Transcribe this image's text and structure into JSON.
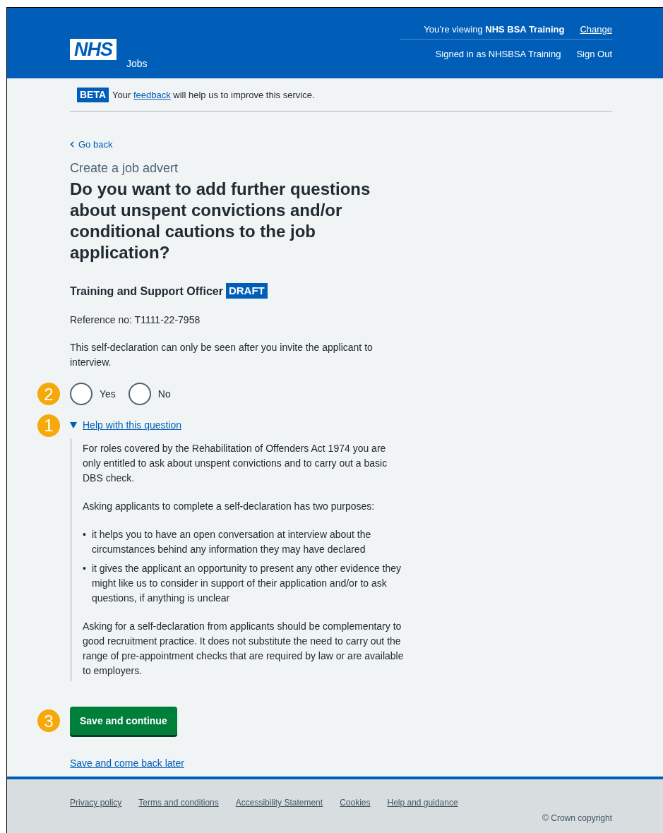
{
  "header": {
    "logo": "NHS",
    "service": "Jobs",
    "viewing_prefix": "You’re viewing",
    "viewing_org": "NHS BSA Training",
    "change_link": "Change",
    "signed_in": "Signed in as NHSBSA Training",
    "sign_out": "Sign Out"
  },
  "beta": {
    "tag": "BETA",
    "prefix": "Your",
    "link": "feedback",
    "suffix": "will help us to improve this service."
  },
  "back_link": "Go back",
  "caption": "Create a job advert",
  "heading": "Do you want to add further questions about unspent convictions and/or conditional cautions to the job application?",
  "job": {
    "title": "Training and Support Officer",
    "status": "DRAFT"
  },
  "reference": "Reference no: T1111-22-7958",
  "hint": "This self-declaration can only be seen after you invite the applicant to interview.",
  "radios": {
    "marker": "2",
    "options": [
      {
        "label": "Yes",
        "selected": false
      },
      {
        "label": "No",
        "selected": false
      }
    ]
  },
  "details": {
    "marker": "1",
    "summary": "Help with this question",
    "expanded": true,
    "paragraphs_before": [
      "For roles covered by the Rehabilitation of Offenders Act 1974 you are only entitled to ask about unspent convictions and to carry out a basic DBS check.",
      "Asking applicants to complete a self-declaration has two purposes:"
    ],
    "bullet_marker": "•",
    "bullets": [
      "it helps you to have an open conversation at interview about the circumstances behind any information they may have declared",
      "it gives the applicant an opportunity to present any other evidence they might like us to consider in support of their application and/or to ask questions, if anything is unclear"
    ],
    "paragraphs_after": [
      "Asking for a self-declaration from applicants should be complementary to good recruitment practice. It does not substitute the need to carry out the range of pre-appointment checks that are required by law or are available to employers."
    ]
  },
  "button": {
    "label": "Save and continue",
    "marker": "3"
  },
  "secondary_link": "Save and come back later",
  "footer": {
    "links": [
      "Privacy policy",
      "Terms and conditions",
      "Accessibility Statement",
      "Cookies",
      "Help and guidance"
    ],
    "copyright": "© Crown copyright"
  }
}
